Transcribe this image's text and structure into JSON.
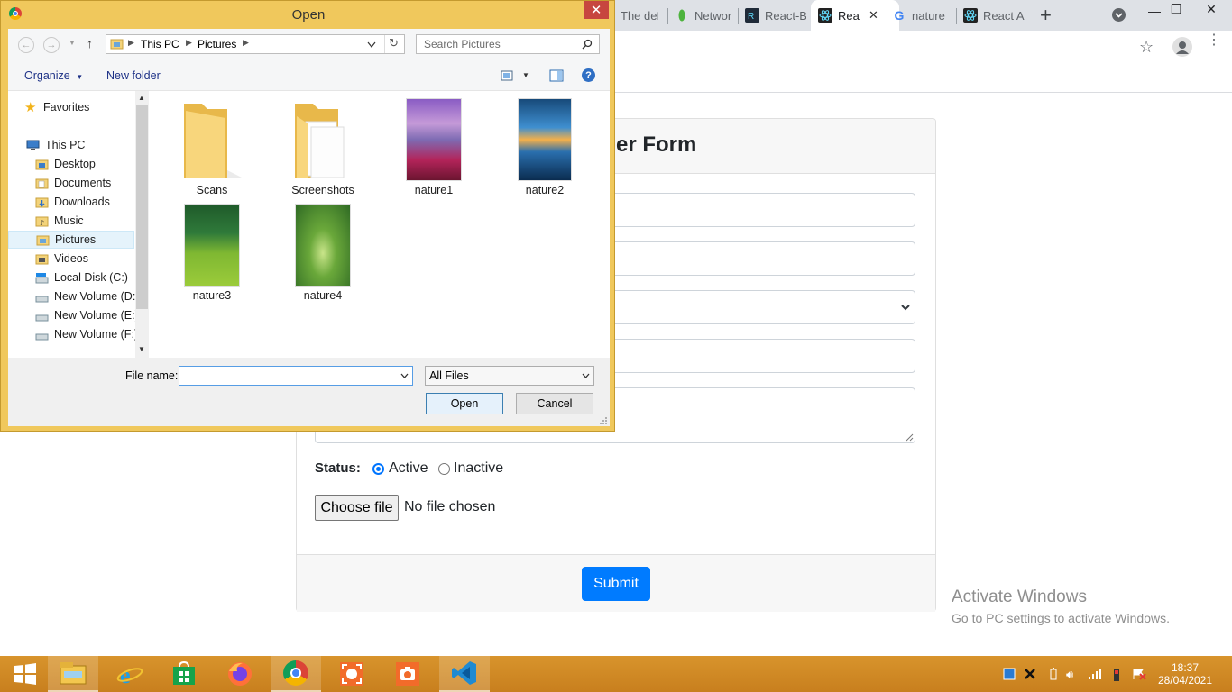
{
  "browser": {
    "tabs": [
      {
        "title": "The def"
      },
      {
        "title": "Networ"
      },
      {
        "title": "React-B"
      },
      {
        "title": "Rea",
        "active": true
      },
      {
        "title": "nature"
      },
      {
        "title": "React A"
      }
    ],
    "new_tab": "+",
    "window_controls": {
      "minimize": "—",
      "restore": "❐",
      "close": "✕"
    }
  },
  "form": {
    "title_visible": "er Form",
    "status_label": "Status:",
    "status_options": [
      {
        "label": "Active",
        "checked": true
      },
      {
        "label": "Inactive",
        "checked": false
      }
    ],
    "choose_file_button": "Choose file",
    "no_file_text": "No file chosen",
    "submit_button": "Submit"
  },
  "watermark": {
    "line1": "Activate Windows",
    "line2": "Go to PC settings to activate Windows."
  },
  "dialog": {
    "title": "Open",
    "close": "✕",
    "breadcrumb": [
      "This PC",
      "Pictures"
    ],
    "search_placeholder": "Search Pictures",
    "organize": "Organize",
    "new_folder": "New folder",
    "nav_tree": [
      {
        "label": "Favorites",
        "icon": "star-icon"
      },
      {
        "label": "This PC",
        "icon": "computer-icon"
      },
      {
        "label": "Desktop",
        "icon": "folder-icon"
      },
      {
        "label": "Documents",
        "icon": "folder-icon"
      },
      {
        "label": "Downloads",
        "icon": "folder-icon"
      },
      {
        "label": "Music",
        "icon": "folder-icon"
      },
      {
        "label": "Pictures",
        "icon": "folder-icon",
        "selected": true
      },
      {
        "label": "Videos",
        "icon": "folder-icon"
      },
      {
        "label": "Local Disk (C:)",
        "icon": "drive-icon"
      },
      {
        "label": "New Volume (D:)",
        "icon": "drive-icon"
      },
      {
        "label": "New Volume (E:)",
        "icon": "drive-icon"
      },
      {
        "label": "New Volume (F:)",
        "icon": "drive-icon"
      }
    ],
    "files": [
      {
        "name": "Scans",
        "kind": "folder"
      },
      {
        "name": "Screenshots",
        "kind": "folder"
      },
      {
        "name": "nature1",
        "kind": "image"
      },
      {
        "name": "nature2",
        "kind": "image"
      },
      {
        "name": "nature3",
        "kind": "image"
      },
      {
        "name": "nature4",
        "kind": "image"
      }
    ],
    "file_name_label": "File name:",
    "file_name_value": "",
    "file_type": "All Files",
    "open_button": "Open",
    "cancel_button": "Cancel"
  },
  "taskbar": {
    "apps": [
      "start-icon",
      "file-explorer-icon",
      "internet-explorer-icon",
      "store-icon",
      "firefox-icon",
      "chrome-icon",
      "screen-recorder-icon",
      "camera-icon",
      "vscode-icon"
    ],
    "time": "18:37",
    "date": "28/04/2021"
  }
}
